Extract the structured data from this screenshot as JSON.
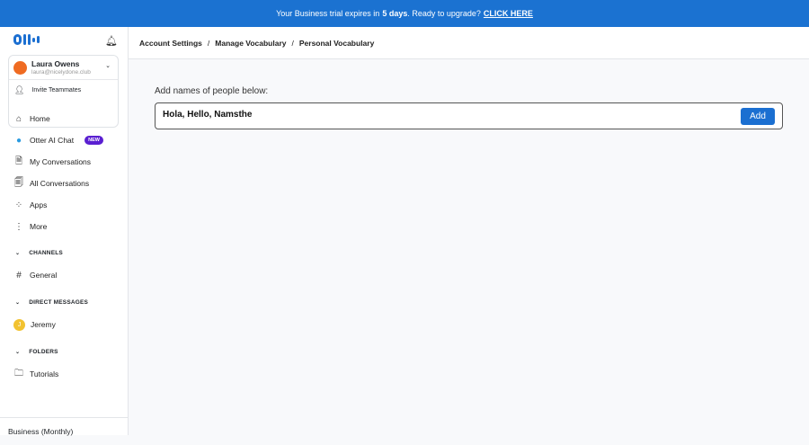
{
  "banner": {
    "prefix": "Your Business trial expires in",
    "days": "5 days",
    "suffix": ". Ready to upgrade?",
    "link": "CLICK HERE"
  },
  "account": {
    "name": "Laura Owens",
    "email": "laura@nicelydone.club",
    "invite": "Invite Teammates"
  },
  "nav": [
    {
      "label": "Home",
      "icon": "home-icon"
    },
    {
      "label": "Otter AI Chat",
      "icon": "otter-chat-icon",
      "badge": "NEW"
    },
    {
      "label": "My Conversations",
      "icon": "conversation-icon"
    },
    {
      "label": "All Conversations",
      "icon": "conversations-icon"
    },
    {
      "label": "Apps",
      "icon": "apps-icon"
    },
    {
      "label": "More",
      "icon": "more-icon"
    }
  ],
  "channels": {
    "title": "CHANNELS",
    "items": [
      "General"
    ]
  },
  "dms": {
    "title": "DIRECT MESSAGES",
    "items": [
      {
        "name": "Jeremy",
        "initial": "J"
      }
    ]
  },
  "folders": {
    "title": "FOLDERS",
    "items": [
      "Tutorials"
    ]
  },
  "plan": "Business (Monthly)",
  "breadcrumb": [
    "Account Settings",
    "Manage Vocabulary",
    "Personal Vocabulary"
  ],
  "main": {
    "label": "Add names of people below:",
    "input_value": "Hola, Hello, Namsthe",
    "add_button": "Add"
  }
}
